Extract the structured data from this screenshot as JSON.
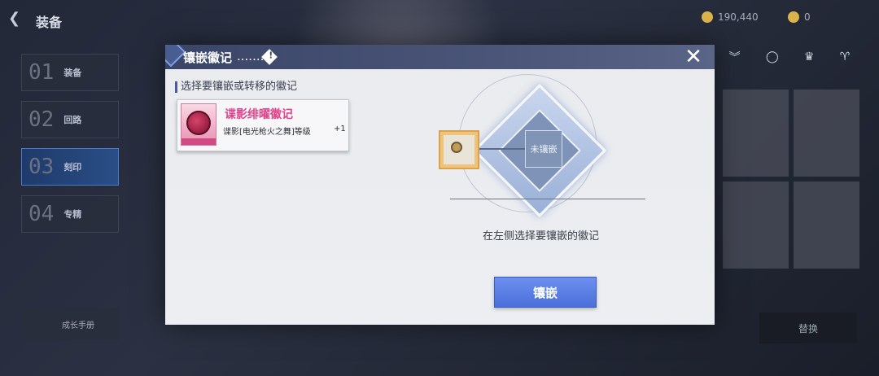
{
  "background": {
    "back_label": "装备",
    "currency": [
      {
        "amount": "190,440",
        "icon": "coin-icon"
      },
      {
        "amount": "0",
        "icon": "crystal-icon"
      }
    ],
    "menu": [
      {
        "num": "01",
        "label": "装备"
      },
      {
        "num": "02",
        "label": "回路"
      },
      {
        "num": "03",
        "label": "刻印"
      },
      {
        "num": "04",
        "label": "专精"
      }
    ],
    "bottom_left_label": "成长手册",
    "bottom_right_label": "替换"
  },
  "dialog": {
    "title": "镶嵌徽记",
    "title_dots": ".......",
    "info_glyph": "!",
    "close_glyph": "✕",
    "section_label": "选择要镶嵌或转移的徽记",
    "emblem": {
      "name": "谍影绯曜徽记",
      "effect": "谍影[电光枪火之舞]等级",
      "level": "+1"
    },
    "slot_label": "未镶嵌",
    "hint": "在左侧选择要镶嵌的徽记",
    "inlay_button": "镶嵌"
  },
  "colors": {
    "header_bg": "#3a4568",
    "emblem_name": "#e0418a",
    "button_bg": "#5a7fe6"
  }
}
